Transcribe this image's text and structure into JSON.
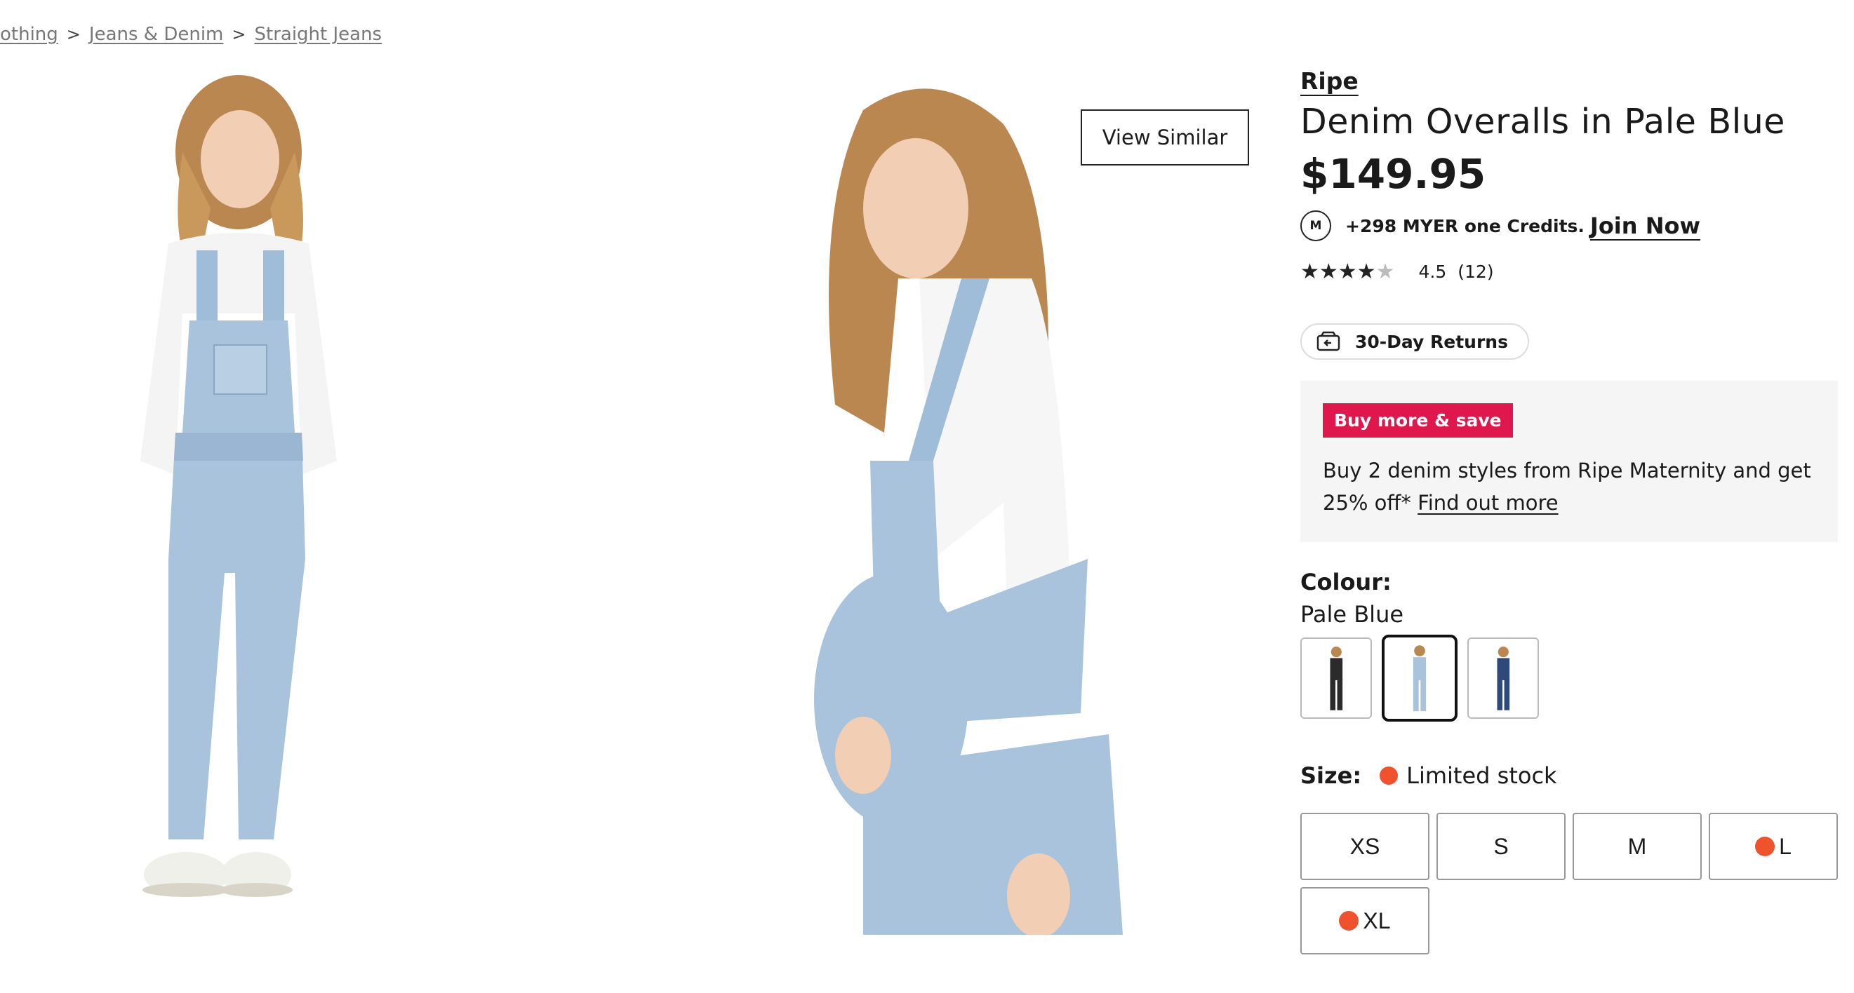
{
  "breadcrumb": [
    {
      "label": "othing"
    },
    {
      "label": "Jeans & Denim"
    },
    {
      "label": "Straight Jeans"
    }
  ],
  "gallery": {
    "view_similar_label": "View Similar"
  },
  "product": {
    "brand": "Ripe",
    "title": "Denim Overalls in Pale Blue",
    "price": "$149.95",
    "credits_text": "+298 MYER one Credits.",
    "join_label": "Join Now",
    "rating_value": "4.5",
    "rating_count": "(12)",
    "returns_label": "30-Day Returns",
    "promo": {
      "badge": "Buy more & save",
      "text": "Buy 2 denim styles from Ripe Maternity and get 25% off* ",
      "link": "Find out more"
    },
    "colour_label": "Colour:",
    "colour_value": "Pale Blue",
    "size_label": "Size:",
    "stock_label": "Limited stock",
    "sizes": [
      {
        "label": "XS",
        "limited": false
      },
      {
        "label": "S",
        "limited": false
      },
      {
        "label": "M",
        "limited": false
      },
      {
        "label": "L",
        "limited": true
      },
      {
        "label": "XL",
        "limited": true
      }
    ]
  },
  "colors": {
    "promo_badge": "#e0174c",
    "limited_dot": "#f0522d",
    "denim_light": "#a9c3dc",
    "denim_dark": "#2f4a7a",
    "denim_black": "#2b2b2b"
  }
}
